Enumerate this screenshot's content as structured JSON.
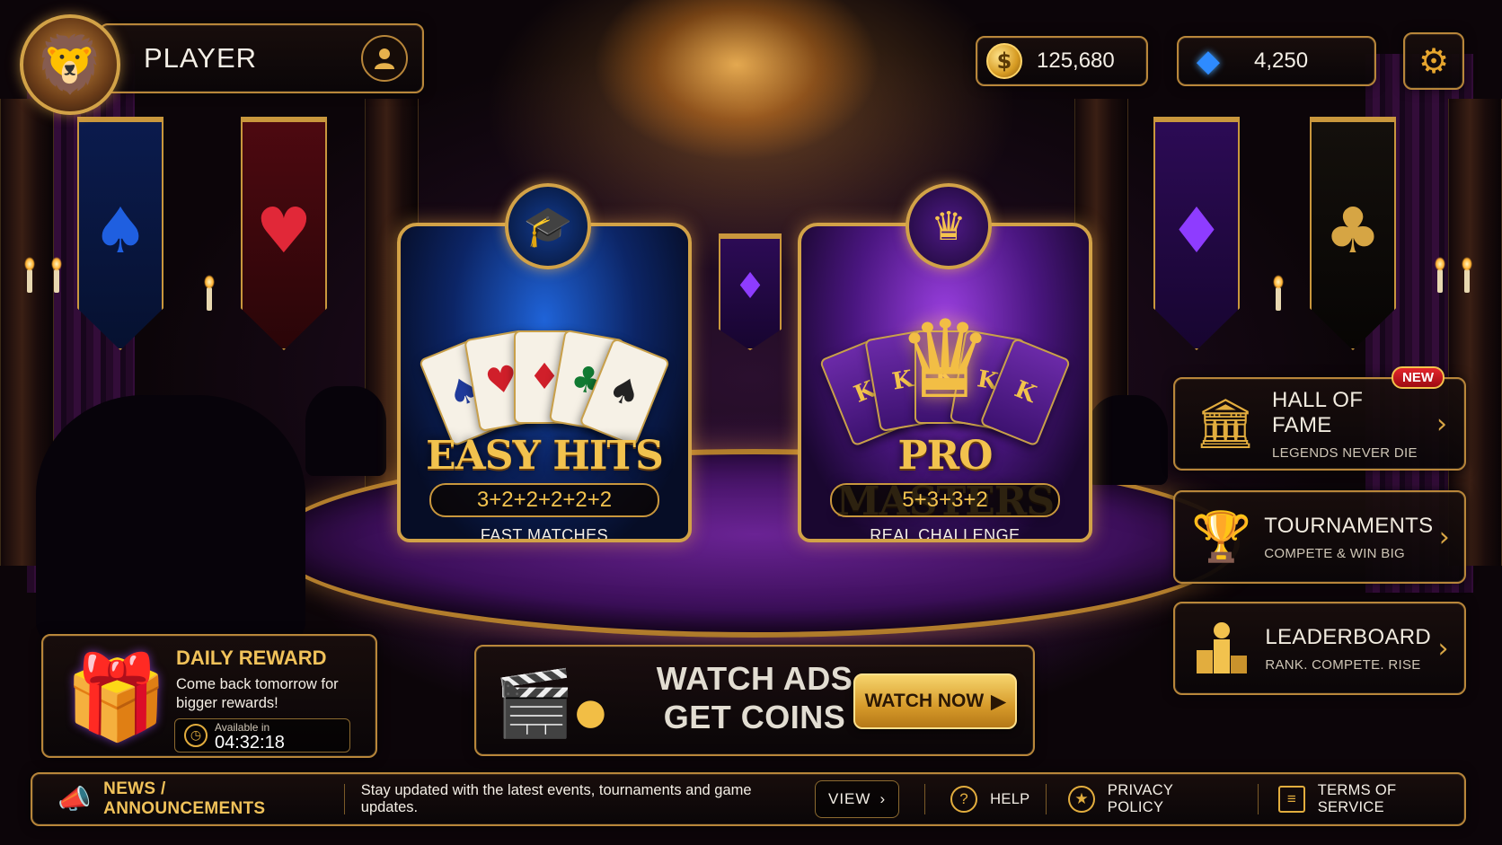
{
  "player": {
    "name": "PLAYER"
  },
  "currency": {
    "coins": "125,680",
    "gems": "4,250"
  },
  "modes": [
    {
      "title": "EASY HITS",
      "formula": "3+2+2+2+2+2",
      "subtitle": "FAST MATCHES"
    },
    {
      "title": "PRO MASTERS",
      "formula": "5+3+3+2",
      "subtitle": "REAL CHALLENGE"
    }
  ],
  "menu": [
    {
      "title": "HALL OF FAME",
      "subtitle": "LEGENDS NEVER DIE",
      "badge": "NEW"
    },
    {
      "title": "TOURNAMENTS",
      "subtitle": "COMPETE & WIN BIG"
    },
    {
      "title": "LEADERBOARD",
      "subtitle": "RANK. COMPETE. RISE"
    }
  ],
  "daily_reward": {
    "title": "DAILY REWARD",
    "description": "Come back tomorrow for bigger rewards!",
    "timer_label": "Available in",
    "timer_value": "04:32:18"
  },
  "ads": {
    "line1": "WATCH ADS",
    "line2": "GET COINS",
    "button": "WATCH NOW"
  },
  "news": {
    "title": "NEWS / ANNOUNCEMENTS",
    "text": "Stay updated with the latest events, tournaments and game updates.",
    "view": "VIEW"
  },
  "links": {
    "help": "HELP",
    "privacy": "PRIVACY POLICY",
    "terms": "TERMS OF SERVICE"
  },
  "icons": {
    "avatar": "lion-icon",
    "profile": "user-icon",
    "coin": "coin-icon",
    "gem": "diamond-icon",
    "settings": "gear-icon",
    "mode1": "graduation-cap-icon",
    "mode2": "crown-icon",
    "hall": "temple-icon",
    "tournament": "trophy-icon",
    "leaderboard": "podium-icon",
    "gift": "gift-icon",
    "clock": "clock-icon",
    "clapper": "clapperboard-icon",
    "megaphone": "megaphone-icon",
    "help": "question-icon",
    "privacy": "shield-icon",
    "terms": "document-icon"
  },
  "colors": {
    "gold": "#f1c25a",
    "border": "#b8863a",
    "blue_mode": "#1f63d8",
    "purple_mode": "#9a3fe0",
    "badge_red": "#e4252c"
  }
}
